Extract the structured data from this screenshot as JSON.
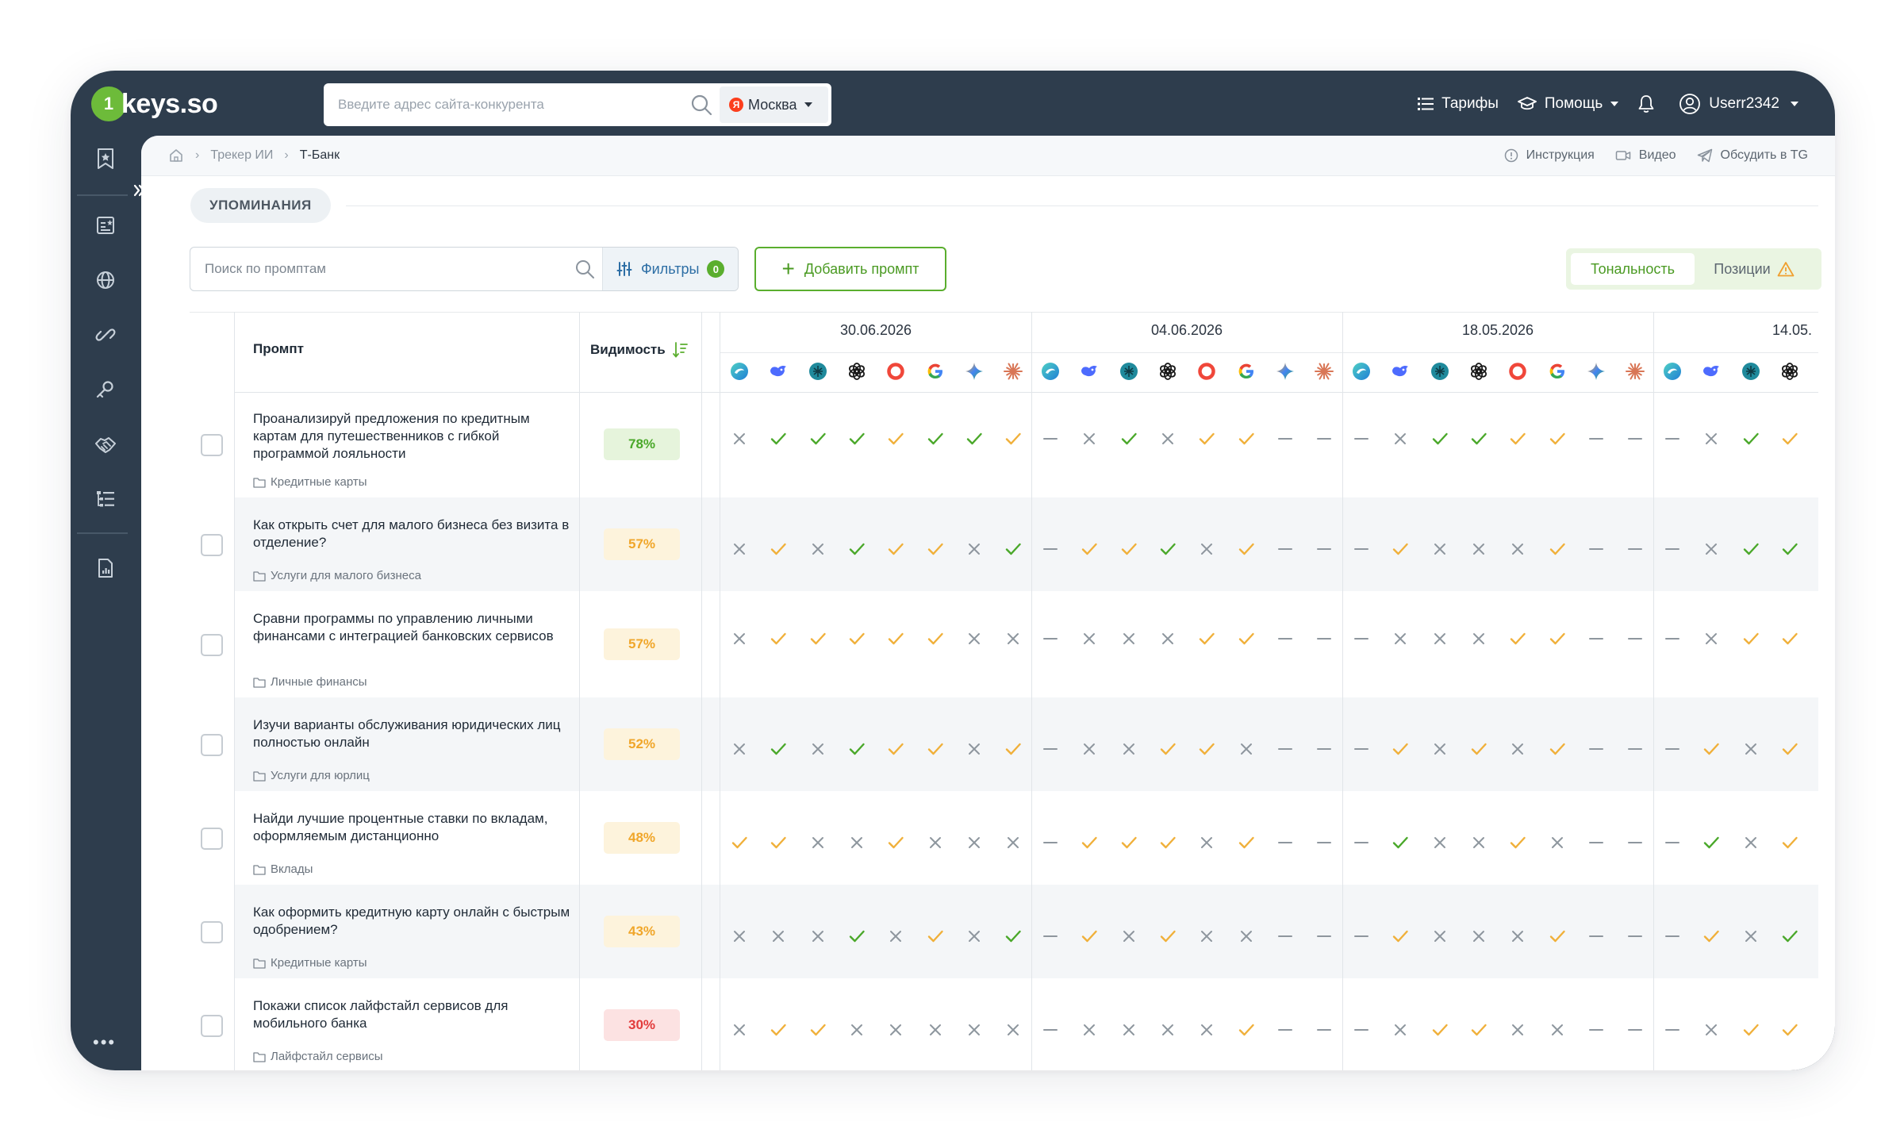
{
  "app": {
    "logo_badge": "1",
    "logo_text": "keys.so"
  },
  "topbar": {
    "site_search_placeholder": "Введите адрес сайта-конкурента",
    "region_badge": "Я",
    "region": "Москва",
    "tariffs": "Тарифы",
    "help": "Помощь",
    "username": "Userr2342"
  },
  "breadcrumb": {
    "level1": "Трекер ИИ",
    "current": "Т-Банк"
  },
  "links": {
    "instruction": "Инструкция",
    "video": "Видео",
    "discuss": "Обсудить в TG"
  },
  "section": {
    "title": "УПОМИНАНИЯ"
  },
  "toolbar": {
    "prompt_search_placeholder": "Поиск по промптам",
    "filters_label": "Фильтры",
    "filters_count": "0",
    "add_prompt": "Добавить промпт",
    "toggle_tone": "Тональность",
    "toggle_positions": "Позиции"
  },
  "table": {
    "col_prompt": "Промпт",
    "col_visibility": "Видимость",
    "dates": [
      "30.06.2026",
      "04.06.2026",
      "18.05.2026",
      "14.05."
    ],
    "models": [
      "alice-icon",
      "deepseek-icon",
      "perplexity-icon",
      "chatgpt-icon",
      "ring-icon",
      "google-icon",
      "gemini-icon",
      "claude-icon"
    ],
    "rows": [
      {
        "prompt": "Проанализируй предложения по кредитным картам для путешественников с гибкой программой лояльности",
        "category": "Кредитные карты",
        "visibility": "78%",
        "level": "high",
        "marks": [
          "x",
          "g",
          "g",
          "g",
          "y",
          "g",
          "g",
          "y",
          "d",
          "x",
          "g",
          "x",
          "y",
          "y",
          "d",
          "d",
          "d",
          "x",
          "g",
          "g",
          "y",
          "y",
          "d",
          "d",
          "d",
          "x",
          "g",
          "y"
        ]
      },
      {
        "prompt": "Как открыть счет для малого бизнеса без визита в отделение?",
        "category": "Услуги для малого бизнеса",
        "visibility": "57%",
        "level": "mid",
        "marks": [
          "x",
          "y",
          "x",
          "g",
          "y",
          "y",
          "x",
          "g",
          "d",
          "y",
          "y",
          "g",
          "x",
          "y",
          "d",
          "d",
          "d",
          "y",
          "x",
          "x",
          "x",
          "y",
          "d",
          "d",
          "d",
          "x",
          "g",
          "g"
        ]
      },
      {
        "prompt": "Сравни программы по управлению личными финансами с интеграцией банковских сервисов",
        "category": "Личные финансы",
        "visibility": "57%",
        "level": "mid",
        "marks": [
          "x",
          "y",
          "y",
          "y",
          "y",
          "y",
          "x",
          "x",
          "d",
          "x",
          "x",
          "x",
          "y",
          "y",
          "d",
          "d",
          "d",
          "x",
          "x",
          "x",
          "y",
          "y",
          "d",
          "d",
          "d",
          "x",
          "y",
          "y"
        ]
      },
      {
        "prompt": "Изучи варианты обслуживания юридических лиц полностью онлайн",
        "category": "Услуги для юрлиц",
        "visibility": "52%",
        "level": "mid",
        "marks": [
          "x",
          "g",
          "x",
          "g",
          "y",
          "y",
          "x",
          "y",
          "d",
          "x",
          "x",
          "y",
          "y",
          "x",
          "d",
          "d",
          "d",
          "y",
          "x",
          "y",
          "x",
          "y",
          "d",
          "d",
          "d",
          "y",
          "x",
          "y"
        ]
      },
      {
        "prompt": "Найди лучшие процентные ставки по вкладам, оформляемым дистанционно",
        "category": "Вклады",
        "visibility": "48%",
        "level": "mid",
        "marks": [
          "y",
          "y",
          "x",
          "x",
          "y",
          "x",
          "x",
          "x",
          "d",
          "y",
          "y",
          "y",
          "x",
          "y",
          "d",
          "d",
          "d",
          "g",
          "x",
          "x",
          "y",
          "x",
          "d",
          "d",
          "d",
          "g",
          "x",
          "y"
        ]
      },
      {
        "prompt": "Как оформить кредитную карту онлайн с быстрым одобрением?",
        "category": "Кредитные карты",
        "visibility": "43%",
        "level": "mid",
        "marks": [
          "x",
          "x",
          "x",
          "g",
          "x",
          "y",
          "x",
          "g",
          "d",
          "y",
          "x",
          "y",
          "x",
          "x",
          "d",
          "d",
          "d",
          "y",
          "x",
          "x",
          "x",
          "y",
          "d",
          "d",
          "d",
          "y",
          "x",
          "g"
        ]
      },
      {
        "prompt": "Покажи список лайфстайл сервисов для мобильного банка",
        "category": "Лайфстайл сервисы",
        "visibility": "30%",
        "level": "low",
        "marks": [
          "x",
          "y",
          "y",
          "x",
          "x",
          "x",
          "x",
          "x",
          "d",
          "x",
          "x",
          "x",
          "x",
          "y",
          "d",
          "d",
          "d",
          "x",
          "y",
          "y",
          "x",
          "x",
          "d",
          "d",
          "d",
          "x",
          "y",
          "y"
        ]
      }
    ]
  },
  "colors": {
    "green": "#4aa82a",
    "yellow": "#f0b03a",
    "gray": "#8e969e",
    "badge_high": "#e6f4dc",
    "badge_mid": "#fdf3dc",
    "badge_low": "#fce2e2"
  }
}
